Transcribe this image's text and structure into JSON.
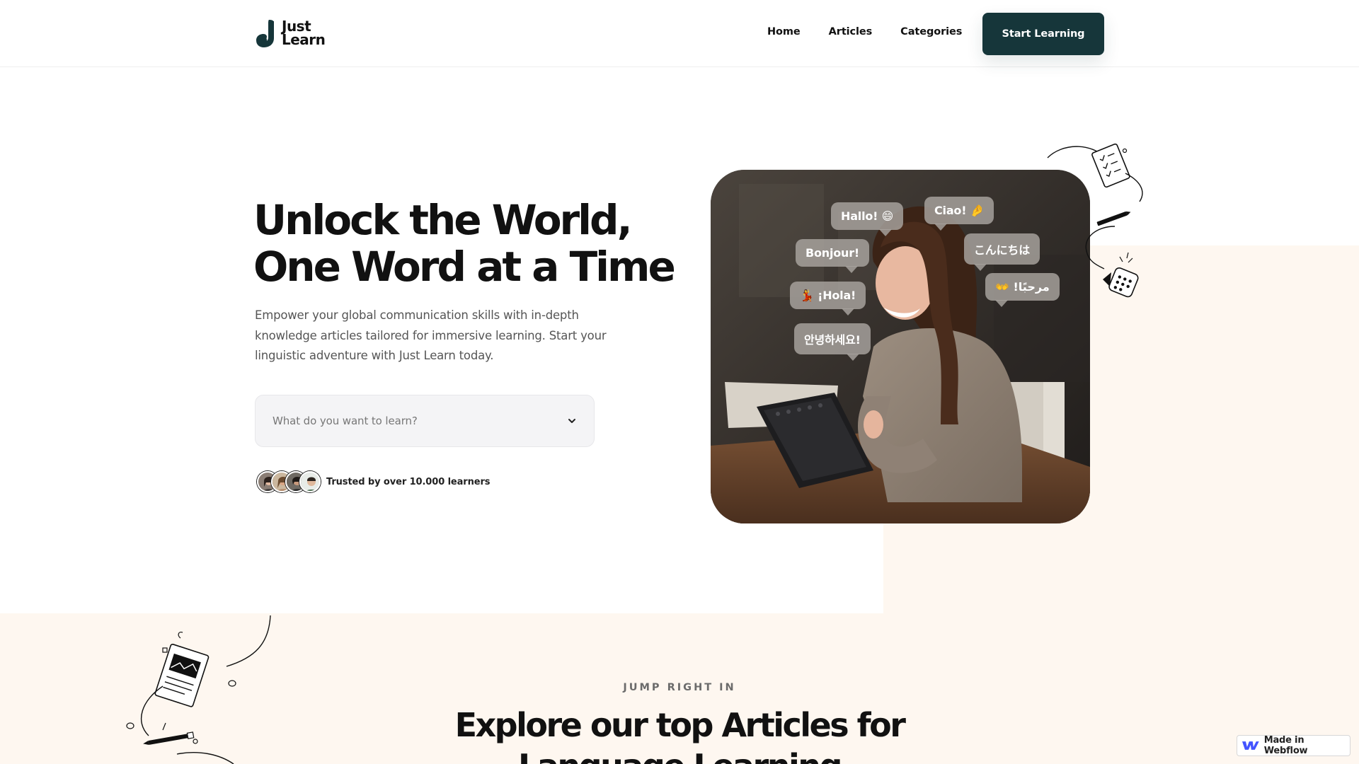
{
  "header": {
    "logo_line1": "Just",
    "logo_line2": "Learn",
    "nav": [
      "Home",
      "Articles",
      "Categories"
    ],
    "cta_label": "Start Learning"
  },
  "hero": {
    "title_line1": "Unlock the World,",
    "title_line2": "One Word at a Time",
    "subtitle": "Empower your global communication skills with in-depth knowledge articles tailored for immersive learning. Start your linguistic adventure with Just Learn today.",
    "select_placeholder": "What do you want to learn?",
    "trust_text": "Trusted by over 10.000 learners",
    "bubbles": {
      "hallo": "Hallo! 😄",
      "ciao": "Ciao! 🤌",
      "bonjour": "Bonjour!",
      "konnichiwa": "こんにちは",
      "hola": "💃 ¡Hola!",
      "marhaba": "👐 !مرحبًا",
      "annyeong": "안녕하세요!"
    }
  },
  "section": {
    "eyebrow": "JUMP RIGHT IN",
    "title_line1": "Explore our top Articles for",
    "title_line2": "Language Learning"
  },
  "badge": {
    "label": "Made in Webflow"
  },
  "colors": {
    "cta_bg": "#16363a",
    "peach_bg": "#fef7f0"
  }
}
